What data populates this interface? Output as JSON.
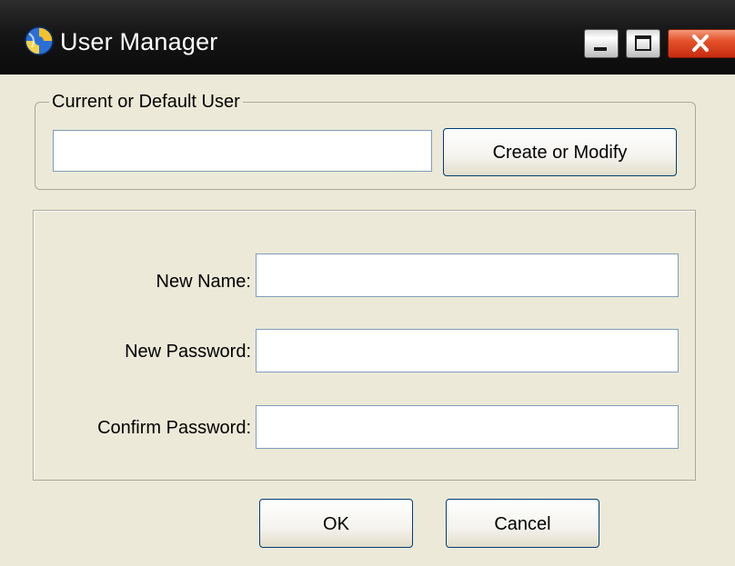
{
  "window": {
    "title": "User Manager",
    "app_icon": "app-globe-icon",
    "controls": {
      "minimize_icon": "minimize-icon",
      "maximize_icon": "maximize-icon",
      "close_icon": "close-icon"
    }
  },
  "current_user": {
    "group_label": "Current or Default User",
    "value": "",
    "create_button_label": "Create or Modify"
  },
  "form": {
    "new_name_label": "New Name:",
    "new_name_value": "",
    "new_password_label": "New Password:",
    "new_password_value": "",
    "confirm_password_label": "Confirm Password:",
    "confirm_password_value": ""
  },
  "actions": {
    "ok_label": "OK",
    "cancel_label": "Cancel"
  },
  "colors": {
    "dialog_background": "#ece9d8",
    "titlebar_background": "#161616",
    "close_button": "#d9401f",
    "input_border": "#7f9db9",
    "button_border": "#003c74"
  }
}
